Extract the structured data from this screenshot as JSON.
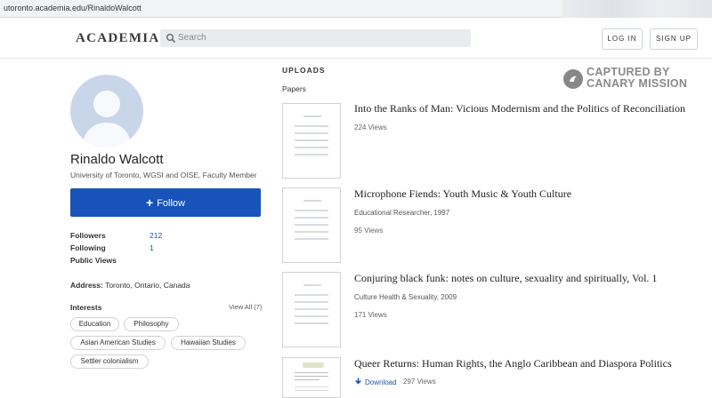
{
  "browser": {
    "url": "utoronto.academia.edu/RinaldoWalcott"
  },
  "header": {
    "logo": "ACADEMIA",
    "search_placeholder": "Search",
    "login_label": "LOG IN",
    "signup_label": "SIGN UP"
  },
  "profile": {
    "name": "Rinaldo Walcott",
    "affiliation": "University of Toronto, WGSI and OISE, Faculty Member",
    "follow_label": "Follow",
    "stats": [
      {
        "label": "Followers",
        "value": "212"
      },
      {
        "label": "Following",
        "value": "1"
      },
      {
        "label": "Public Views",
        "value": ""
      }
    ],
    "address_label": "Address:",
    "address_value": "Toronto, Ontario, Canada",
    "interests_title": "Interests",
    "view_all": "View All (7)",
    "interests": [
      "Education",
      "Philosophy",
      "Asian American Studies",
      "Hawaiian Studies",
      "Settler colonialism"
    ]
  },
  "uploads": {
    "heading": "UPLOADS",
    "subheading": "Papers",
    "papers": [
      {
        "title": "Into the Ranks of Man: Vicious Modernism and the Politics of Reconciliation",
        "meta": "",
        "views": "224 Views"
      },
      {
        "title": "Microphone Fiends: Youth Music & Youth Culture",
        "meta": "Educational Researcher, 1997",
        "views": "95 Views"
      },
      {
        "title": "Conjuring black funk: notes on culture, sexuality and spiritually, Vol. 1",
        "meta": "Culture Health & Sexuality, 2009",
        "views": "171 Views"
      },
      {
        "title": "Queer Returns: Human Rights, the Anglo Caribbean and Diaspora Politics",
        "meta": "",
        "views": "297 Views",
        "download_label": "Download"
      }
    ]
  },
  "watermark": {
    "line1": "CAPTURED BY",
    "line2": "CANARY MISSION"
  },
  "colors": {
    "accent": "#1753b8",
    "avatar_bg": "#c9d6ea"
  }
}
